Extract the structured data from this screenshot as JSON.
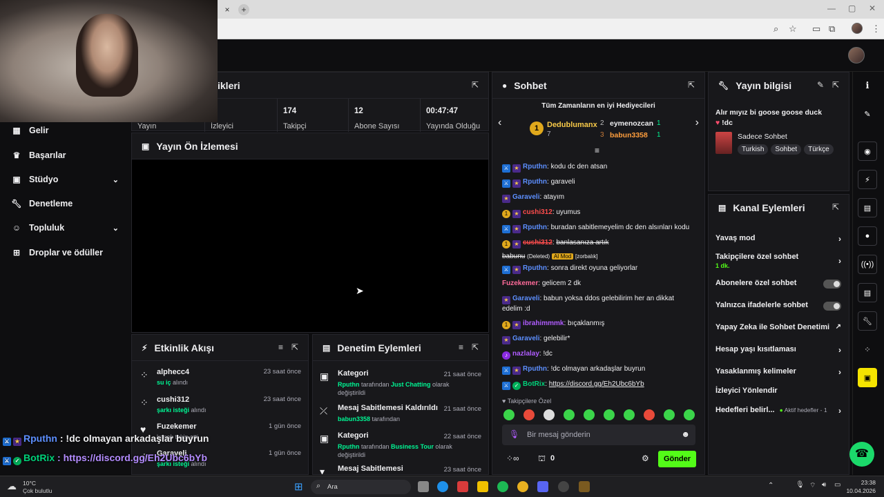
{
  "browser": {
    "close_tab": "×",
    "new_tab": "+"
  },
  "sidebar": {
    "items": [
      {
        "label": "Gelir",
        "icon": "bank-icon"
      },
      {
        "label": "Başarılar",
        "icon": "trophy-icon"
      },
      {
        "label": "Stüdyo",
        "icon": "studio-icon",
        "chevron": true
      },
      {
        "label": "Denetleme",
        "icon": "wrench-icon"
      },
      {
        "label": "Topluluk",
        "icon": "community-icon",
        "chevron": true
      },
      {
        "label": "Droplar ve ödüller",
        "icon": "drops-icon"
      }
    ]
  },
  "stats": {
    "title_fragment": "ikleri",
    "cells": [
      {
        "value": "",
        "label": "Yayın"
      },
      {
        "value": "",
        "label": "İzleyici"
      },
      {
        "value": "174",
        "label": "Takipçi"
      },
      {
        "value": "12",
        "label": "Abone Sayısı"
      },
      {
        "value": "00:47:47",
        "label": "Yayında Olduğu"
      }
    ]
  },
  "preview": {
    "title": "Yayın Ön İzlemesi"
  },
  "activity": {
    "title": "Etkinlik Akışı",
    "items": [
      {
        "name": "alphecc4",
        "sub_highlight": "su iç",
        "sub_rest": " alındı",
        "time": "23 saat önce",
        "icon": "points-icon"
      },
      {
        "name": "cushi312",
        "sub_highlight": "şarkı isteği",
        "sub_rest": " alındı",
        "time": "23 saat önce",
        "icon": "points-icon"
      },
      {
        "name": "Fuzekemer",
        "sub_highlight": "",
        "sub_rest": "kanalı takip etti",
        "time": "1 gün önce",
        "icon": "heart-icon"
      },
      {
        "name": "Garaveli",
        "sub_highlight": "şarkı isteği",
        "sub_rest": " alındı",
        "time": "1 gün önce",
        "icon": "points-icon"
      }
    ]
  },
  "mod_actions": {
    "title": "Denetim Eylemleri",
    "items": [
      {
        "title": "Kategori",
        "user": "Rputhn",
        "mid": " tarafından ",
        "target": "Just Chatting",
        "rest": " olarak değiştirildi",
        "time": "21 saat önce",
        "icon": "category-icon"
      },
      {
        "title": "Mesaj Sabitlemesi Kaldırıldı",
        "user": "babun3358",
        "mid": " tarafından",
        "target": "",
        "rest": "",
        "time": "21 saat önce",
        "icon": "unpin-icon"
      },
      {
        "title": "Kategori",
        "user": "Rputhn",
        "mid": " tarafından ",
        "target": "Business Tour",
        "rest": " olarak değiştirildi",
        "time": "22 saat önce",
        "icon": "category-icon"
      },
      {
        "title": "Mesaj Sabitlemesi",
        "user": "",
        "mid": "",
        "target": "",
        "rest": "",
        "time": "23 saat önce",
        "icon": "pin-icon"
      }
    ]
  },
  "chat": {
    "title": "Sohbet",
    "gifters_title": "Tüm Zamanların en iyi Hediyecileri",
    "gifters": [
      {
        "rank": "1",
        "name": "Dedublumanx",
        "count": "7"
      },
      {
        "rank": "2",
        "name": "eymenozcan",
        "count": "1"
      },
      {
        "rank": "3",
        "name": "babun3358",
        "count": "1"
      }
    ],
    "messages": [
      {
        "user": "Rputhn",
        "color": "#5d8fff",
        "badges": [
          "mod",
          "vip"
        ],
        "text": "kodu dc den atsan"
      },
      {
        "user": "Rputhn",
        "color": "#5d8fff",
        "badges": [
          "mod",
          "vip"
        ],
        "text": "garaveli"
      },
      {
        "user": "Garaveli",
        "color": "#5d8fff",
        "badges": [
          "vip"
        ],
        "text": "atayım"
      },
      {
        "user": "cushi312",
        "color": "#ff4d4d",
        "badges": [
          "gold",
          "vip"
        ],
        "text": "uyumus"
      },
      {
        "user": "Rputhn",
        "color": "#5d8fff",
        "badges": [
          "mod",
          "vip"
        ],
        "text": "buradan sabitlemeyelim dc den alsınları kodu"
      },
      {
        "user": "cushi312",
        "color": "#ff4d4d",
        "badges": [
          "gold",
          "vip"
        ],
        "text": "banlasanıza artık"
      },
      {
        "user": "Rputhn",
        "color": "#5d8fff",
        "badges": [
          "mod",
          "vip"
        ],
        "text": "sonra direkt oyuna geliyorlar"
      },
      {
        "user": "Fuzekemer",
        "color": "#ff6b9a",
        "badges": [],
        "text": "gelicem 2 dk"
      },
      {
        "user": "Garaveli",
        "color": "#5d8fff",
        "badges": [
          "vip"
        ],
        "text": "babun yoksa ddos gelebilirim her an dikkat edelim :d"
      },
      {
        "user": "ibrahimmmk",
        "color": "#b05cff",
        "badges": [
          "gold",
          "vip"
        ],
        "text": "bıçaklanmış"
      },
      {
        "user": "Garaveli",
        "color": "#5d8fff",
        "badges": [
          "vip"
        ],
        "text": "gelebilir*"
      },
      {
        "user": "nazlalay",
        "color": "#b05cff",
        "badges": [
          "mic"
        ],
        "text": "!dc"
      },
      {
        "user": "Rputhn",
        "color": "#5d8fff",
        "badges": [
          "mod",
          "vip"
        ],
        "text": "!dc olmayan arkadaşlar buyrun"
      },
      {
        "user": "BotRix",
        "color": "#00d27a",
        "badges": [
          "mod",
          "bot"
        ],
        "text": "https://discord.gg/Eh2Ubc6bYb"
      }
    ],
    "deleted_line": {
      "user": "babunu",
      "deleted": "(Deleted)",
      "tag": "AI Mod",
      "reason": "[zorbalık]"
    },
    "followers_only": "Takipçilere Özel",
    "input_placeholder": "Bir mesaj gönderin",
    "points": "0",
    "send": "Gönder"
  },
  "stream_info": {
    "title": "Yayın bilgisi",
    "stream_title": "Alır mıyız bi goose goose duck",
    "command": "!dc",
    "category": "Sadece Sohbet",
    "tags": [
      "Turkish",
      "Sohbet",
      "Türkçe"
    ]
  },
  "channel_actions": {
    "title": "Kanal Eylemleri",
    "rows": [
      {
        "label": "Yavaş mod",
        "kind": "chevron"
      },
      {
        "label": "Takipçilere özel sohbet",
        "kind": "chevron",
        "sub": "1 dk."
      },
      {
        "label": "Abonelere özel sohbet",
        "kind": "toggle"
      },
      {
        "label": "Yalnızca ifadelerle sohbet",
        "kind": "toggle"
      },
      {
        "label": "Yapay Zeka ile Sohbet Denetimi",
        "kind": "external"
      },
      {
        "label": "Hesap yaşı kısıtlaması",
        "kind": "chevron"
      },
      {
        "label": "Yasaklanmış kelimeler",
        "kind": "chevron"
      },
      {
        "label": "İzleyici Yönlendir",
        "kind": "none"
      },
      {
        "label": "Hedefleri belirl...",
        "kind": "chevron",
        "extra": "Aktif hedefler - 1"
      }
    ]
  },
  "overlay_chat": [
    {
      "user": "Rputhn",
      "text": " : !dc olmayan arkadaşlar buyrun",
      "color": "#5d8fff"
    },
    {
      "user": "BotRix",
      "text": " : https://discord.gg/Eh2Ubc6bYb",
      "color": "#00d27a"
    }
  ],
  "taskbar": {
    "temp": "10°C",
    "weather": "Çok bulutlu",
    "search": "Ara",
    "time": "23:38",
    "date": "10.04.2026"
  }
}
